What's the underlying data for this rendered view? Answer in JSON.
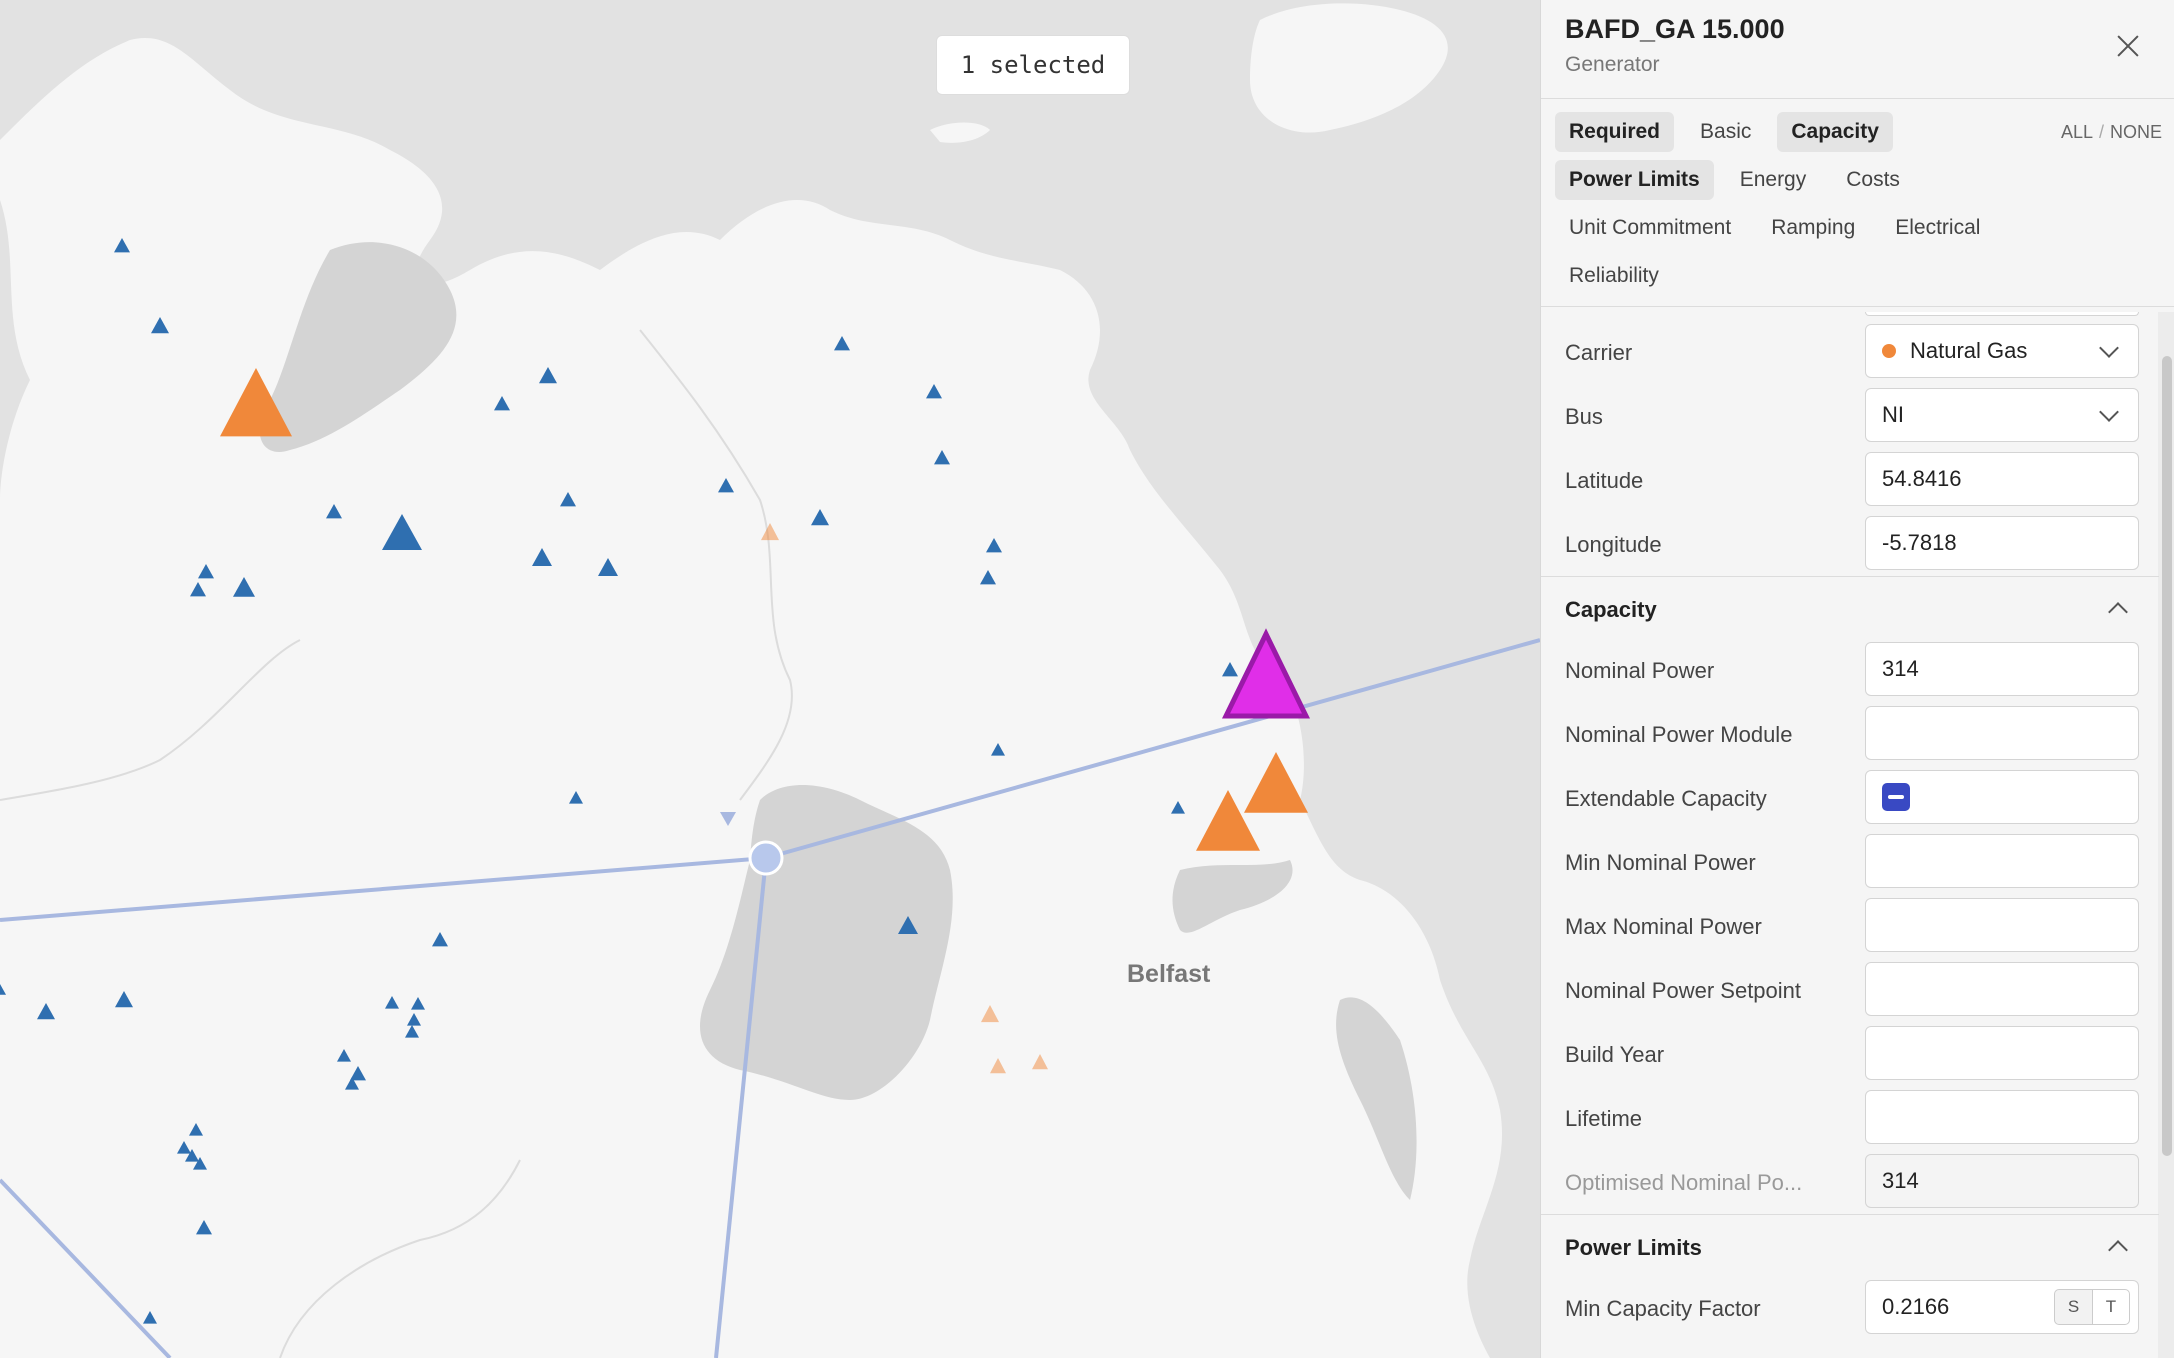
{
  "map": {
    "selection_badge": "1 selected",
    "city_label": "Belfast"
  },
  "panel": {
    "title": "BAFD_GA 15.000",
    "subtitle": "Generator",
    "tabs_row1": [
      "Required",
      "Basic",
      "Capacity"
    ],
    "tabs_row2": [
      "Power Limits",
      "Energy",
      "Costs"
    ],
    "tabs_row3": [
      "Unit Commitment",
      "Ramping",
      "Electrical"
    ],
    "tabs_row4": [
      "Reliability"
    ],
    "all_label": "ALL",
    "none_label": "NONE",
    "fields_top": [
      {
        "label": "Carrier",
        "value": "Natural Gas",
        "type": "select",
        "color": "#f0883a"
      },
      {
        "label": "Bus",
        "value": "NI",
        "type": "select"
      },
      {
        "label": "Latitude",
        "value": "54.8416",
        "type": "input"
      },
      {
        "label": "Longitude",
        "value": "-5.7818",
        "type": "input"
      }
    ],
    "capacity_section": "Capacity",
    "capacity_fields": [
      {
        "label": "Nominal Power",
        "value": "314"
      },
      {
        "label": "Nominal Power Module",
        "value": ""
      },
      {
        "label": "Extendable Capacity",
        "value": ""
      },
      {
        "label": "Min Nominal Power",
        "value": ""
      },
      {
        "label": "Max Nominal Power",
        "value": ""
      },
      {
        "label": "Nominal Power Setpoint",
        "value": ""
      },
      {
        "label": "Build Year",
        "value": ""
      },
      {
        "label": "Lifetime",
        "value": ""
      },
      {
        "label": "Optimised Nominal Po...",
        "value": "314"
      }
    ],
    "power_limits_section": "Power Limits",
    "power_limit_fields": [
      {
        "label": "Min Capacity Factor",
        "value": "0.2166",
        "s": "S",
        "t": "T"
      }
    ]
  },
  "colors": {
    "small_gen": "#2f6fb0",
    "gas_gen": "#f0883a",
    "selected_gen": "#e02ee8",
    "line": "#a8b8e0"
  }
}
